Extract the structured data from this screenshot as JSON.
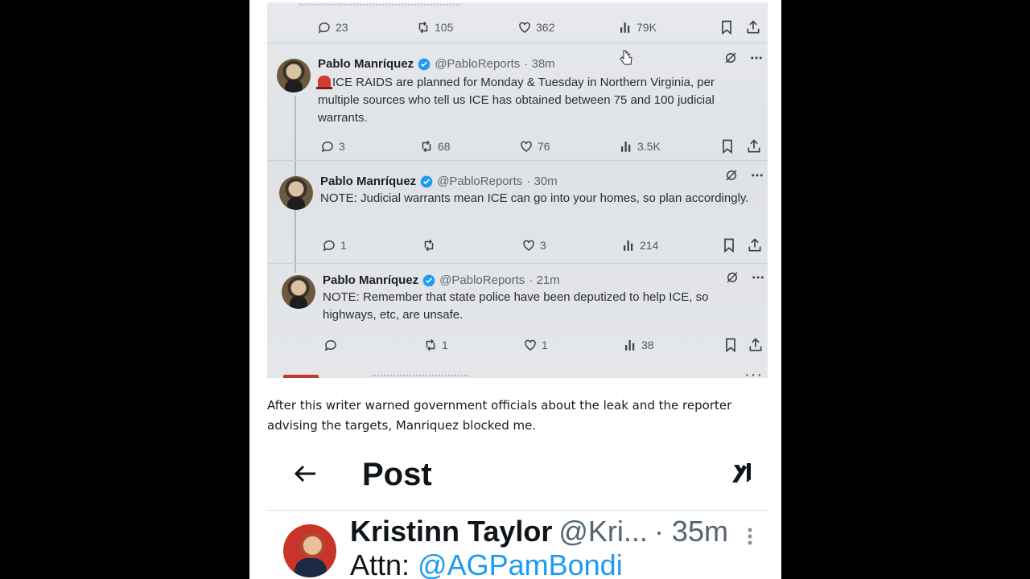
{
  "photo": {
    "top_metrics": {
      "replies": "23",
      "reposts": "105",
      "likes": "362",
      "views": "79K"
    },
    "tweets": [
      {
        "name": "Pablo Manríquez",
        "handle": "@PabloReports",
        "time": "· 38m",
        "text": "ICE RAIDS are planned for Monday & Tuesday in Northern Virginia, per multiple sources who tell us ICE has obtained between 75 and 100 judicial warrants.",
        "replies": "3",
        "reposts": "68",
        "likes": "76",
        "views": "3.5K"
      },
      {
        "name": "Pablo Manríquez",
        "handle": "@PabloReports",
        "time": "· 30m",
        "text": "NOTE: Judicial warrants mean ICE can go into your homes, so plan accordingly.",
        "replies": "1",
        "reposts": "",
        "likes": "3",
        "views": "214"
      },
      {
        "name": "Pablo Manríquez",
        "handle": "@PabloReports",
        "time": "· 21m",
        "text": "NOTE: Remember that state police have been deputized to help ICE, so highways, etc, are unsafe.",
        "replies": "",
        "reposts": "1",
        "likes": "1",
        "views": "38"
      }
    ]
  },
  "caption": "After this writer warned government officials about the leak and the reporter advising the targets, Manriquez blocked me.",
  "post": {
    "title": "Post",
    "author_name": "Kristinn Taylor",
    "author_handle": "@Kri...",
    "time": "· 35m",
    "text_prefix": "Attn: ",
    "mention": "@AGPamBondi"
  },
  "colors": {
    "mention": "#1d9bf0",
    "verified": "#1d9bf0",
    "text": "#0f1419"
  }
}
